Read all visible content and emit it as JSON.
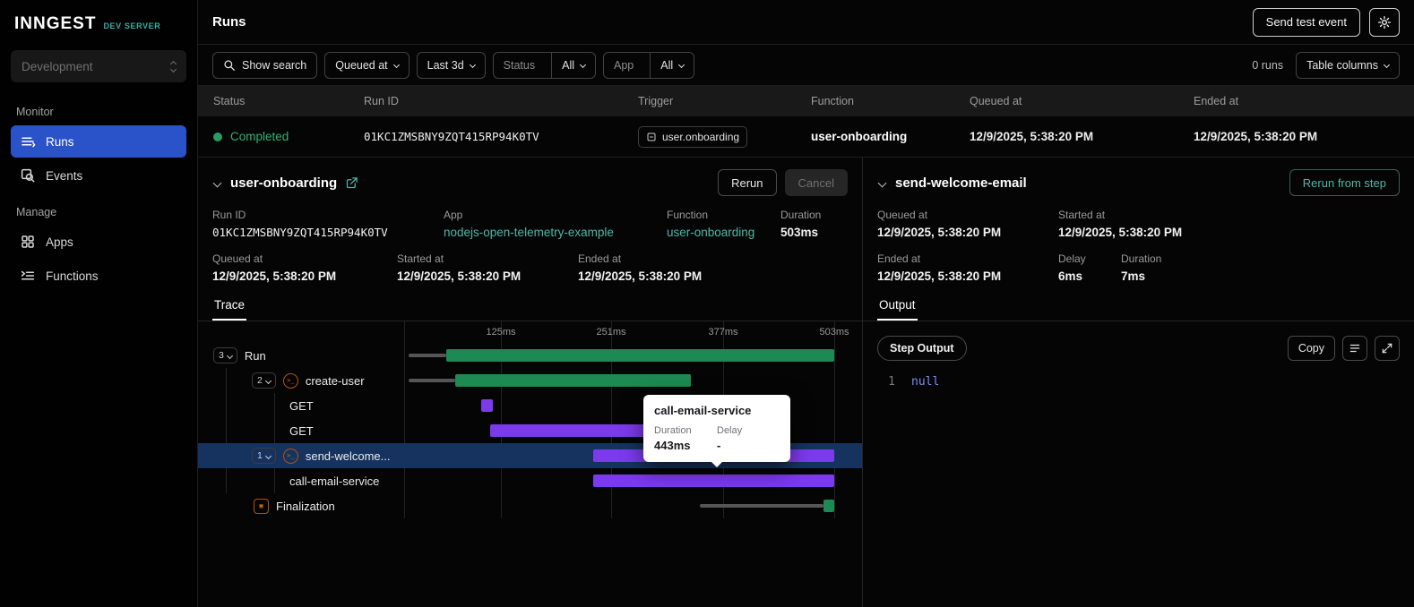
{
  "colors": {
    "accent_teal": "#4cb8a8",
    "dev_badge_teal": "#2fb3a3",
    "active_nav_blue": "#2a52c9",
    "success_green": "#2c9b63",
    "trace_bar_green": "#1c8a52",
    "trace_bar_purple": "#7c3aed",
    "highlight_row_navy": "#163360",
    "code_null_blue": "#818cf8"
  },
  "sidebar": {
    "logo": "INNGEST",
    "badge": "DEV SERVER",
    "env": "Development",
    "monitor_label": "Monitor",
    "manage_label": "Manage",
    "runs": "Runs",
    "events": "Events",
    "apps": "Apps",
    "functions": "Functions"
  },
  "header": {
    "title": "Runs",
    "send_test_event": "Send test event"
  },
  "filters": {
    "show_search": "Show search",
    "queued_at": "Queued at",
    "range": "Last 3d",
    "status_label": "Status",
    "status_value": "All",
    "app_label": "App",
    "app_value": "All",
    "runs_count": "0 runs",
    "table_columns": "Table columns"
  },
  "table": {
    "headers": [
      "Status",
      "Run ID",
      "Trigger",
      "Function",
      "Queued at",
      "Ended at"
    ],
    "row": {
      "status": "Completed",
      "run_id": "01KC1ZMSBNY9ZQT415RP94K0TV",
      "trigger": "user.onboarding",
      "function": "user-onboarding",
      "queued_at": "12/9/2025, 5:38:20 PM",
      "ended_at": "12/9/2025, 5:38:20 PM"
    }
  },
  "run_panel": {
    "title": "user-onboarding",
    "rerun": "Rerun",
    "cancel": "Cancel",
    "run_id_label": "Run ID",
    "run_id": "01KC1ZMSBNY9ZQT415RP94K0TV",
    "app_label": "App",
    "app": "nodejs-open-telemetry-example",
    "function_label": "Function",
    "function": "user-onboarding",
    "duration_label": "Duration",
    "duration": "503ms",
    "queued_label": "Queued at",
    "queued": "12/9/2025, 5:38:20 PM",
    "started_label": "Started at",
    "started": "12/9/2025, 5:38:20 PM",
    "ended_label": "Ended at",
    "ended": "12/9/2025, 5:38:20 PM",
    "tab": "Trace"
  },
  "trace": {
    "axis": [
      "125ms",
      "251ms",
      "377ms",
      "503ms"
    ],
    "rows": {
      "run": {
        "badge": "3",
        "label": "Run"
      },
      "create_user": {
        "badge": "2",
        "label": "create-user"
      },
      "get1": {
        "label": "GET"
      },
      "get2": {
        "label": "GET"
      },
      "send_welcome": {
        "badge": "1",
        "label": "send-welcome..."
      },
      "call_email": {
        "label": "call-email-service"
      },
      "finalization": {
        "label": "Finalization"
      }
    },
    "tooltip": {
      "title": "call-email-service",
      "duration_label": "Duration",
      "duration": "443ms",
      "delay_label": "Delay",
      "delay": "-"
    }
  },
  "step_panel": {
    "title": "send-welcome-email",
    "rerun_from_step": "Rerun from step",
    "queued_label": "Queued at",
    "queued": "12/9/2025, 5:38:20 PM",
    "started_label": "Started at",
    "started": "12/9/2025, 5:38:20 PM",
    "ended_label": "Ended at",
    "ended": "12/9/2025, 5:38:20 PM",
    "delay_label": "Delay",
    "delay": "6ms",
    "duration_label": "Duration",
    "duration": "7ms",
    "tab": "Output",
    "step_output": "Step Output",
    "copy": "Copy",
    "code_line_no": "1",
    "code_value": "null"
  }
}
